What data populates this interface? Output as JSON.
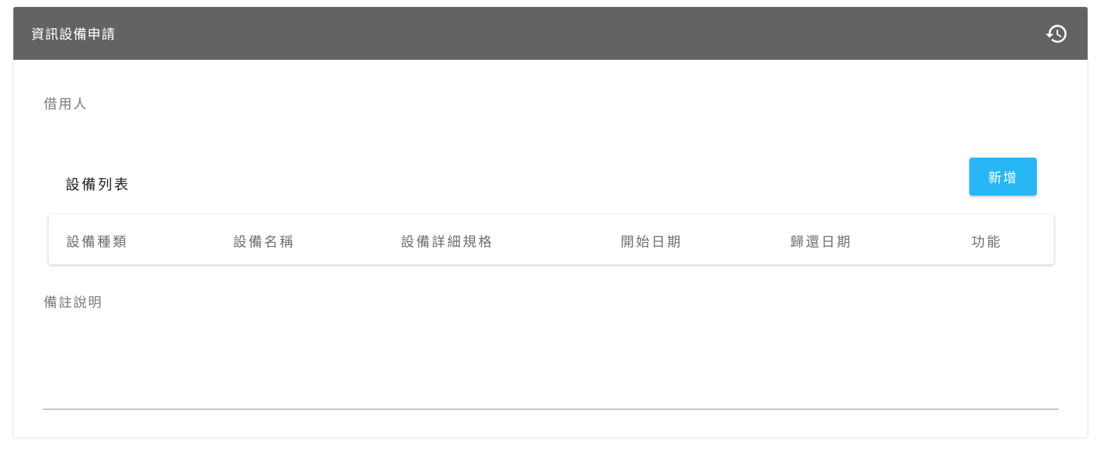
{
  "header": {
    "title": "資訊設備申請",
    "history_icon": "history-icon"
  },
  "form": {
    "borrower_label": "借用人",
    "remark_label": "備註說明"
  },
  "equipment_list": {
    "title": "設備列表",
    "add_label": "新增",
    "columns": [
      "設備種類",
      "設備名稱",
      "設備詳細規格",
      "開始日期",
      "歸還日期",
      "功能"
    ]
  },
  "colors": {
    "header_bg": "#636363",
    "accent": "#29b6f6"
  }
}
